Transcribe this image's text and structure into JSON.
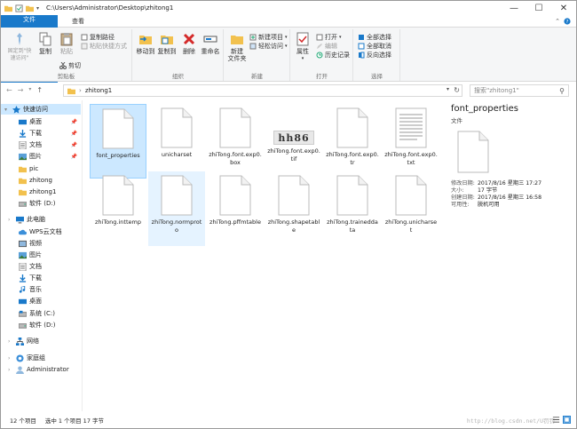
{
  "window": {
    "title_path": "C:\\Users\\Administrator\\Desktop\\zhitong1",
    "controls": [
      "—",
      "☐",
      "✕"
    ]
  },
  "ribbon_tabs": [
    "文件",
    "主页",
    "共享",
    "查看"
  ],
  "ribbon": {
    "clipboard": {
      "label": "剪贴板",
      "pin_quick_access": "固定到\"快\n速访问\"",
      "copy": "复制",
      "paste": "粘贴",
      "copy_path": "复制路径",
      "paste_shortcut": "粘贴快捷方式",
      "cut": "剪切"
    },
    "organize": {
      "label": "组织",
      "move_to": "移动到",
      "copy_to": "复制到",
      "delete": "删除",
      "rename": "重命名"
    },
    "new": {
      "label": "新建",
      "new_folder": "新建\n文件夹",
      "new_item": "新建项目",
      "easy_access": "轻松访问"
    },
    "open": {
      "label": "打开",
      "properties": "属性",
      "open": "打开",
      "edit": "编辑",
      "history": "历史记录"
    },
    "select": {
      "label": "选择",
      "select_all": "全部选择",
      "select_none": "全部取消",
      "invert": "反向选择"
    }
  },
  "address": {
    "breadcrumb": "zhitong1",
    "search_placeholder": "搜索\"zhitong1\""
  },
  "nav": {
    "quick_access": "快速访问",
    "items": [
      {
        "label": "桌面",
        "pinned": true
      },
      {
        "label": "下载",
        "pinned": true
      },
      {
        "label": "文档",
        "pinned": true
      },
      {
        "label": "图片",
        "pinned": true
      },
      {
        "label": "pic"
      },
      {
        "label": "zhitong"
      },
      {
        "label": "zhitong1"
      },
      {
        "label": "软件 (D:)"
      }
    ],
    "this_pc": "此电脑",
    "pc_items": [
      "WPS云文档",
      "视频",
      "图片",
      "文档",
      "下载",
      "音乐",
      "桌面",
      "系统 (C:)",
      "软件 (D:)"
    ],
    "network": "网络",
    "homegroup": "家庭组",
    "admin": "Administrator"
  },
  "files": [
    {
      "name": "font_properties"
    },
    {
      "name": "unicharset"
    },
    {
      "name": "zhiTong.font.exp0.box"
    },
    {
      "name": "zhiTong.font.exp0.tif",
      "thumb_text": "hh86"
    },
    {
      "name": "zhiTong.font.exp0.tr"
    },
    {
      "name": "zhiTong.font.exp0.txt"
    },
    {
      "name": "zhiTong.inttemp"
    },
    {
      "name": "zhiTong.normproto"
    },
    {
      "name": "zhiTong.pffmtable"
    },
    {
      "name": "zhiTong.shapetable"
    },
    {
      "name": "zhiTong.traineddata"
    },
    {
      "name": "zhiTong.unicharset"
    }
  ],
  "preview": {
    "title": "font_properties",
    "type": "文件",
    "props": [
      {
        "k": "修改日期:",
        "v": "2017/8/16 星期三 17:27"
      },
      {
        "k": "大小:",
        "v": "17 字节"
      },
      {
        "k": "创建日期:",
        "v": "2017/8/16 星期三 16:58"
      },
      {
        "k": "可用性:",
        "v": "脱机可用"
      }
    ]
  },
  "status": {
    "count": "12 个项目",
    "selected": "选中 1 个项目  17 字节",
    "watermark": "http://blog.csdn.net/U罚罚"
  },
  "colors": {
    "accent": "#1979ca",
    "selection": "#cce8ff"
  }
}
